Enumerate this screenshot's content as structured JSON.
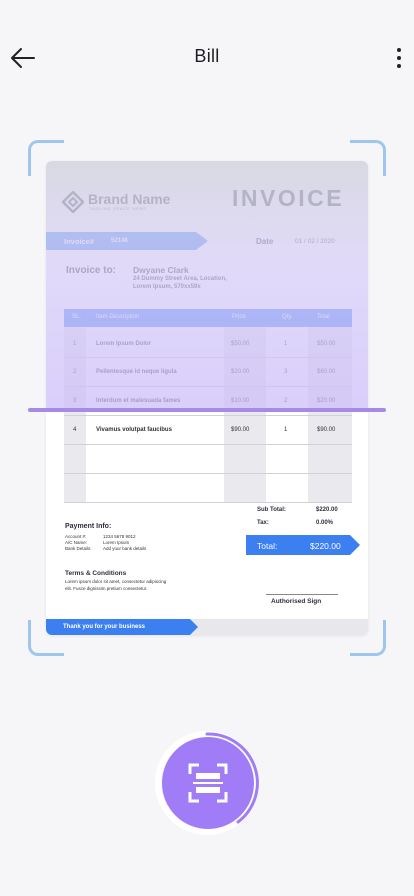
{
  "header": {
    "title": "Bill",
    "back_icon": "arrow-left-icon",
    "more_icon": "more-vertical-icon"
  },
  "invoice": {
    "brand_name": "Brand Name",
    "brand_tagline": "TAGLINE SPACE HERE",
    "title": "INVOICE",
    "invoice_label": "Invoice#",
    "invoice_number": "52148",
    "date_label": "Date",
    "date_value": "01 / 02 / 2020",
    "to_label": "Invoice to:",
    "client_name": "Dwyane Clark",
    "client_address": "24 Dummy Street Area, Location, Lorem Ipsum, 570xx59x",
    "columns": [
      "SL.",
      "Item Description",
      "Price",
      "Qty.",
      "Total"
    ],
    "rows": [
      {
        "sl": "1",
        "desc": "Lorem Ipsum Dolor",
        "price": "$50.00",
        "qty": "1",
        "total": "$50.00"
      },
      {
        "sl": "2",
        "desc": "Pellentesque id neque ligula",
        "price": "$20.00",
        "qty": "3",
        "total": "$60.00"
      },
      {
        "sl": "3",
        "desc": "Interdum et malesuada fames",
        "price": "$10.00",
        "qty": "2",
        "total": "$20.00"
      },
      {
        "sl": "4",
        "desc": "Vivamus volutpat faucibus",
        "price": "$90.00",
        "qty": "1",
        "total": "$90.00"
      }
    ],
    "subtotal_label": "Sub Total:",
    "subtotal_value": "$220.00",
    "tax_label": "Tax:",
    "tax_value": "0.00%",
    "total_label": "Total:",
    "total_value": "$220.00",
    "payment_title": "Payment Info:",
    "payment_lines": [
      {
        "label": "Account #:",
        "value": "1234 5678 9012"
      },
      {
        "label": "A/C Name:",
        "value": "Lorem Ipsum"
      },
      {
        "label": "Bank Details:",
        "value": "Add your bank details"
      }
    ],
    "terms_title": "Terms & Conditions",
    "terms_line1": "Lorem ipsum dolor sit amet, consectetur adipiscing",
    "terms_line2": "elit. Fusce dignissim pretium consectetur.",
    "signature_label": "Authorised Sign",
    "footer_text": "Thank you for your business"
  },
  "scan": {
    "icon": "scan-icon"
  },
  "colors": {
    "accent_blue": "#3b7ff0",
    "scan_purple": "#a07cf6",
    "frame_blue": "#9ec6ee"
  }
}
